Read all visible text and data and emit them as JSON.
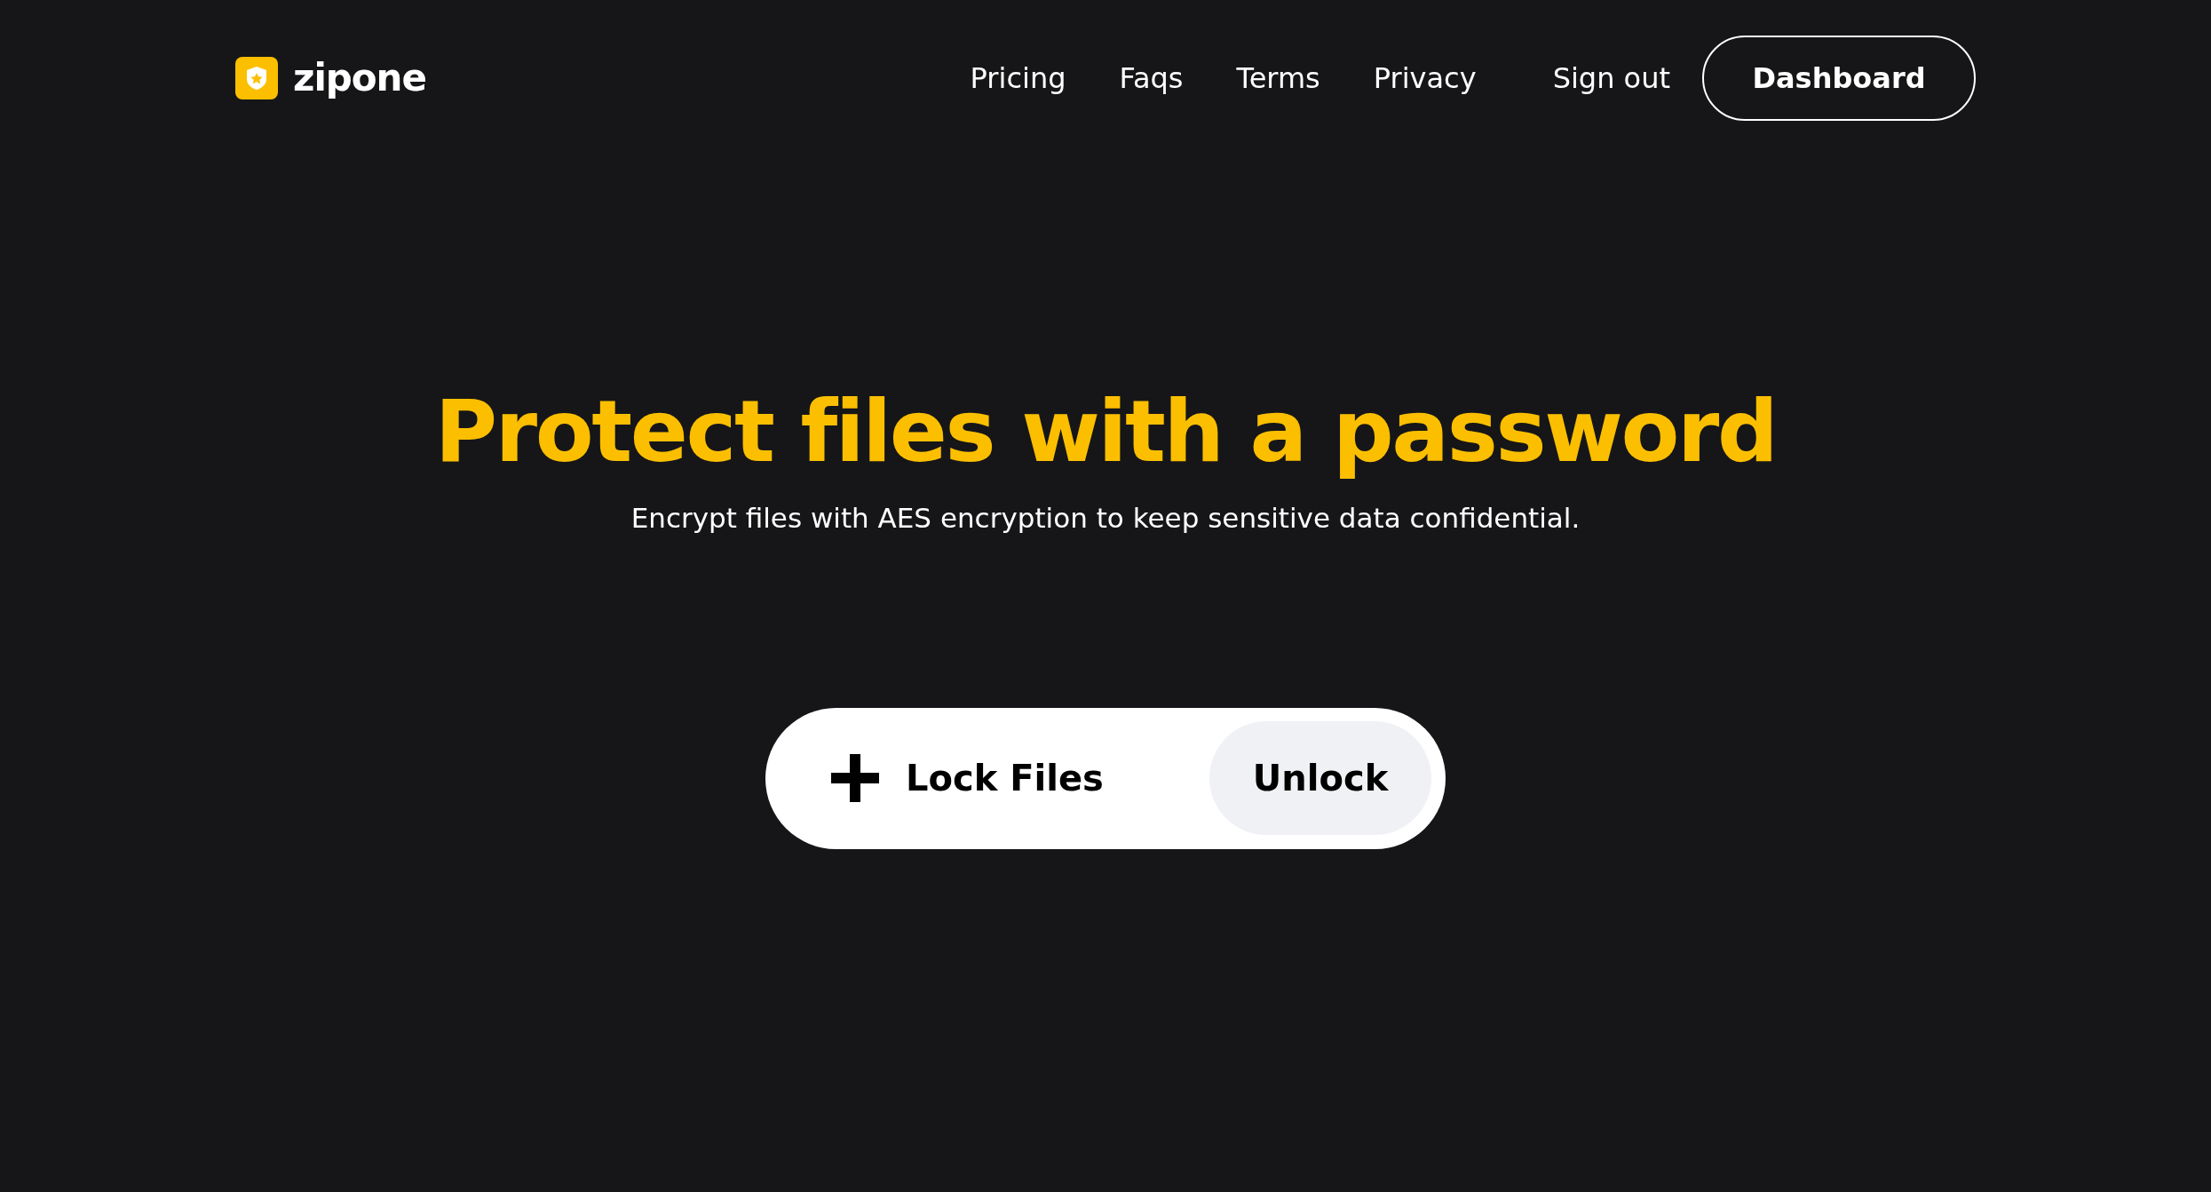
{
  "brand": {
    "name": "zipone"
  },
  "nav": {
    "links": [
      "Pricing",
      "Faqs",
      "Terms",
      "Privacy"
    ],
    "sign_out": "Sign out",
    "dashboard": "Dashboard"
  },
  "hero": {
    "title": "Protect files with a password",
    "subtitle": "Encrypt files with AES encryption to keep sensitive data confidential."
  },
  "actions": [
    {
      "label": "Lock Files",
      "kind": "add"
    },
    {
      "label": "Unlock",
      "kind": "secondary"
    }
  ]
}
